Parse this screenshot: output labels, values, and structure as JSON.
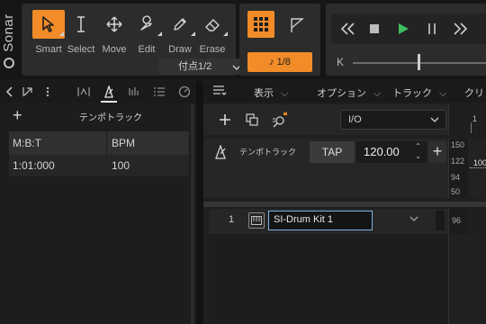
{
  "app": {
    "name": "Sonar"
  },
  "tools": [
    {
      "label": "Smart",
      "icon": "cursor-arrow-icon",
      "active": true
    },
    {
      "label": "Select",
      "icon": "text-cursor-icon",
      "active": false
    },
    {
      "label": "Move",
      "icon": "move-arrows-icon",
      "active": false
    },
    {
      "label": "Edit",
      "icon": "wrench-icon",
      "active": false
    },
    {
      "label": "Draw",
      "icon": "pencil-icon",
      "active": false
    },
    {
      "label": "Erase",
      "icon": "eraser-icon",
      "active": false
    }
  ],
  "snap": {
    "value": "付点1/2"
  },
  "grid": {
    "note_value": "1/8"
  },
  "transport": {
    "scrub_label": "K",
    "scrub_position": 0.45
  },
  "left_pane": {
    "tempo_title": "テンポトラック",
    "table": {
      "headers": [
        "M:B:T",
        "BPM"
      ],
      "rows": [
        {
          "mbt": "1:01:000",
          "bpm": "100"
        }
      ]
    }
  },
  "menubar": {
    "items": [
      "表示",
      "オプション",
      "トラック",
      "クリッ"
    ]
  },
  "track_toolbar": {
    "io_value": "I/O"
  },
  "ruler": {
    "bar_number": "1"
  },
  "tempo_track": {
    "label": "テンポトラック",
    "tap_label": "TAP",
    "bpm_value": "120.00",
    "scale": [
      "150",
      "122",
      "94",
      "50"
    ],
    "lane_value": "100"
  },
  "track": {
    "number": "1",
    "name": "SI-Drum Kit 1",
    "lane_value": "96"
  },
  "colors": {
    "accent": "#f28c28",
    "play": "#3fbf5f",
    "selection": "#7fb4e6"
  }
}
